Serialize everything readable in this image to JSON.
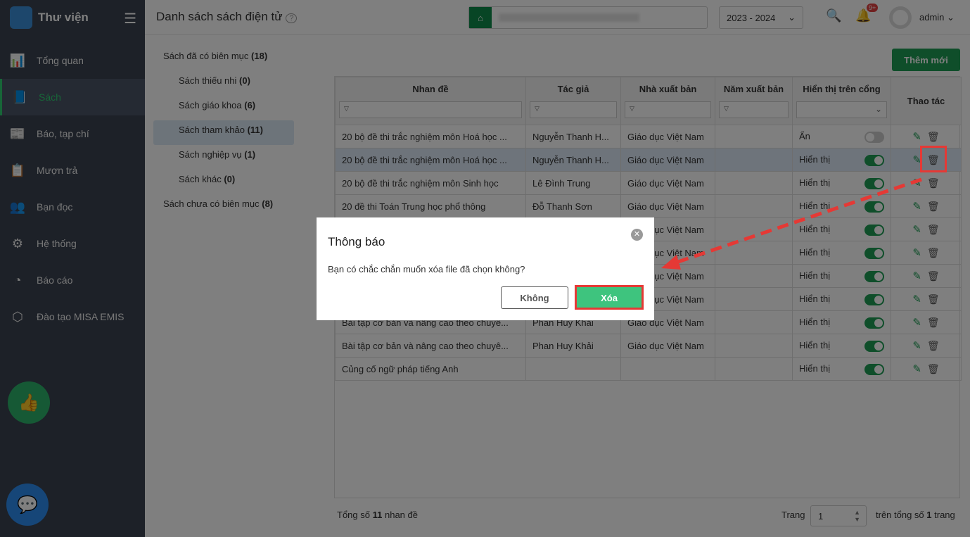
{
  "sidebar": {
    "app_title": "Thư viện",
    "items": [
      {
        "label": "Tổng quan",
        "icon": "chart-icon"
      },
      {
        "label": "Sách",
        "icon": "book-icon"
      },
      {
        "label": "Báo, tạp chí",
        "icon": "newspaper-icon"
      },
      {
        "label": "Mượn trả",
        "icon": "hand-book-icon"
      },
      {
        "label": "Bạn đọc",
        "icon": "reader-icon"
      },
      {
        "label": "Hệ thống",
        "icon": "gear-icon"
      },
      {
        "label": "Báo cáo",
        "icon": "pie-icon"
      },
      {
        "label": "Đào tạo MISA EMIS",
        "icon": "cube-icon"
      }
    ]
  },
  "header": {
    "title": "Danh sách sách điện tử",
    "year": "2023 - 2024",
    "notif_badge": "9+",
    "user": "admin"
  },
  "categories": [
    {
      "label": "Sách đã có biên mục",
      "count": "(18)"
    },
    {
      "label": "Sách thiếu nhi",
      "count": "(0)"
    },
    {
      "label": "Sách giáo khoa",
      "count": "(6)"
    },
    {
      "label": "Sách tham khảo",
      "count": "(11)"
    },
    {
      "label": "Sách nghiệp vụ",
      "count": "(1)"
    },
    {
      "label": "Sách khác",
      "count": "(0)"
    },
    {
      "label": "Sách chưa có biên mục",
      "count": "(8)"
    }
  ],
  "add_button": "Thêm mới",
  "table": {
    "columns": [
      "Nhan đề",
      "Tác giả",
      "Nhà xuất bản",
      "Năm xuất bản",
      "Hiển thị trên cổng",
      "Thao tác"
    ],
    "rows": [
      {
        "title": "20 bộ đề thi trắc nghiệm môn Hoá học ...",
        "author": "Nguyễn Thanh H...",
        "publisher": "Giáo dục Việt Nam",
        "year": "",
        "display": "Ẩn",
        "on": false
      },
      {
        "title": "20 bộ đề thi trắc nghiệm môn Hoá học ...",
        "author": "Nguyễn Thanh H...",
        "publisher": "Giáo dục Việt Nam",
        "year": "",
        "display": "Hiển thị",
        "on": true
      },
      {
        "title": "20 bộ đề thi trắc nghiệm môn Sinh học",
        "author": "Lê Đình Trung",
        "publisher": "Giáo dục Việt Nam",
        "year": "",
        "display": "Hiển thị",
        "on": true
      },
      {
        "title": "20 đề thi Toán Trung học phổ thông",
        "author": "Đỗ Thanh Sơn",
        "publisher": "Giáo dục Việt Nam",
        "year": "",
        "display": "Hiển thị",
        "on": true
      },
      {
        "title": "",
        "author": "",
        "publisher": "Giáo dục Việt Nam",
        "year": "",
        "display": "Hiển thị",
        "on": true
      },
      {
        "title": "",
        "author": "",
        "publisher": "Giáo dục Việt Nam",
        "year": "",
        "display": "Hiển thị",
        "on": true
      },
      {
        "title": "",
        "author": "",
        "publisher": "Giáo dục Việt Nam",
        "year": "",
        "display": "Hiển thị",
        "on": true
      },
      {
        "title": "",
        "author": "",
        "publisher": "Giáo dục Việt Nam",
        "year": "",
        "display": "Hiển thị",
        "on": true
      },
      {
        "title": "Bài tập cơ bản và nâng cao theo chuyê...",
        "author": "Phan Huy Khải",
        "publisher": "Giáo dục Việt Nam",
        "year": "",
        "display": "Hiển thị",
        "on": true
      },
      {
        "title": "Bài tập cơ bản và nâng cao theo chuyê...",
        "author": "Phan Huy Khải",
        "publisher": "Giáo dục Việt Nam",
        "year": "",
        "display": "Hiển thị",
        "on": true
      },
      {
        "title": "Củng cố ngữ pháp tiếng Anh",
        "author": "",
        "publisher": "",
        "year": "",
        "display": "Hiển thị",
        "on": true
      }
    ]
  },
  "footer": {
    "total_prefix": "Tổng số",
    "total": "11",
    "total_suffix": "nhan đề",
    "page_label": "Trang",
    "page": "1",
    "of_prefix": "trên tổng số",
    "pages": "1",
    "of_suffix": "trang"
  },
  "dialog": {
    "title": "Thông báo",
    "message": "Bạn có chắc chắn muốn xóa file đã chọn không?",
    "cancel": "Không",
    "confirm": "Xóa"
  },
  "colors": {
    "accent": "#1f9d55",
    "highlight": "#e53935"
  }
}
